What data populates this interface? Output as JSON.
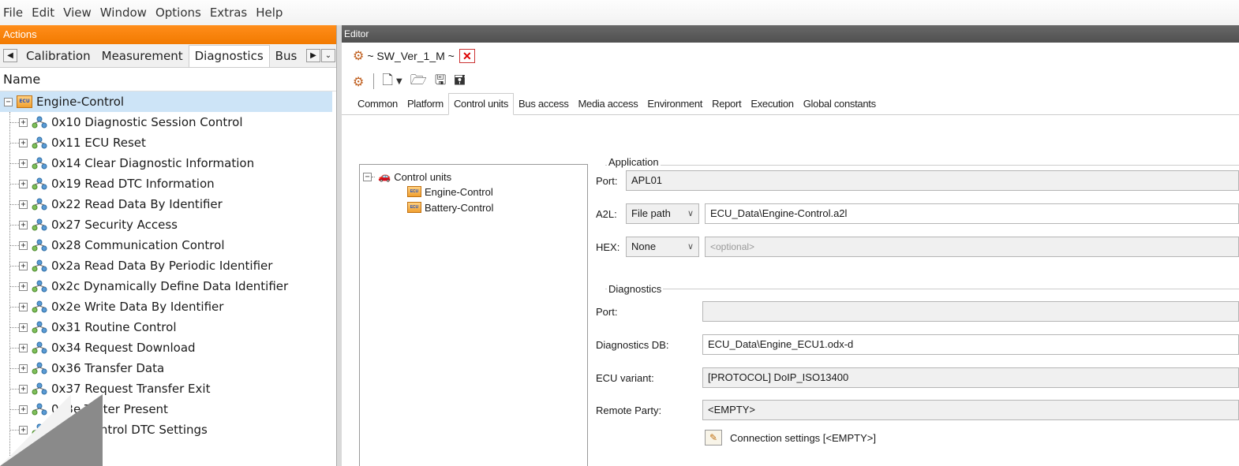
{
  "menu": [
    "File",
    "Edit",
    "View",
    "Window",
    "Options",
    "Extras",
    "Help"
  ],
  "actions_panel": {
    "title": "Actions",
    "tabs": [
      "Calibration",
      "Measurement",
      "Diagnostics",
      "Bus"
    ],
    "active_tab": "Diagnostics",
    "column_header": "Name",
    "root": "Engine-Control",
    "root_icon_text": "ECU",
    "services": [
      "0x10 Diagnostic Session Control",
      "0x11 ECU Reset",
      "0x14 Clear Diagnostic Information",
      "0x19 Read DTC Information",
      "0x22 Read Data By Identifier",
      "0x27 Security Access",
      "0x28 Communication Control",
      "0x2a Read Data By Periodic Identifier",
      "0x2c Dynamically Define Data Identifier",
      "0x2e Write Data By Identifier",
      "0x31 Routine Control",
      "0x34 Request Download",
      "0x36 Transfer Data",
      "0x37 Request Transfer Exit",
      "0x3e Tester Present",
      "0x85 Control DTC Settings"
    ]
  },
  "editor": {
    "title": "Editor",
    "doc_tab": "~ SW_Ver_1_M ~",
    "config_tabs": [
      "Common",
      "Platform",
      "Control units",
      "Bus access",
      "Media access",
      "Environment",
      "Report",
      "Execution",
      "Global constants"
    ],
    "active_config_tab": "Control units",
    "control_units": {
      "root": "Control units",
      "items": [
        "Engine-Control",
        "Battery-Control"
      ],
      "icon_text": "ECU"
    },
    "application": {
      "group": "Application",
      "port_label": "Port:",
      "port_value": "APL01",
      "a2l_label": "A2L:",
      "a2l_mode": "File path",
      "a2l_value": "ECU_Data\\Engine-Control.a2l",
      "hex_label": "HEX:",
      "hex_mode": "None",
      "hex_placeholder": "<optional>"
    },
    "diagnostics": {
      "group": "Diagnostics",
      "port_label": "Port:",
      "port_value": "",
      "db_label": "Diagnostics DB:",
      "db_value": "ECU_Data\\Engine_ECU1.odx-d",
      "variant_label": "ECU variant:",
      "variant_value": "[PROTOCOL] DoIP_ISO13400",
      "remote_label": "Remote Party:",
      "remote_value": "<EMPTY>",
      "connection_button": "Connection settings [<EMPTY>]"
    }
  }
}
